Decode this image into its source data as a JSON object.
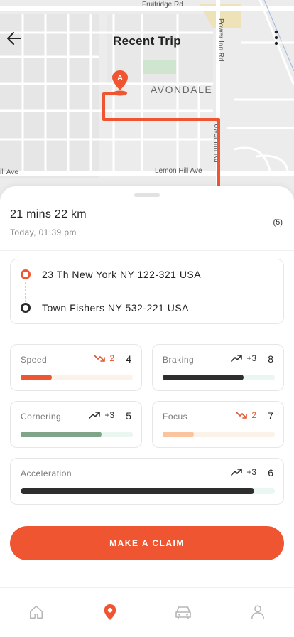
{
  "header": {
    "title": "Recent Trip"
  },
  "map": {
    "labels": {
      "fruitridge": "Fruitridge Rd",
      "power_inn_top": "Power Inn Rd",
      "power_inn_mid": "Power Inn Rd",
      "avondale": "AVONDALE",
      "lemon_hill": "Lemon Hill Ave",
      "hill_ave": "ill Ave"
    },
    "marker_label": "A",
    "route_color": "#ef5530"
  },
  "trip": {
    "summary": "21 mins 22 km",
    "time": "Today, 01:39 pm",
    "rating": "(5)",
    "start_address": "23 Th New York NY 122-321 USA",
    "end_address": "Town Fishers NY 532-221 USA"
  },
  "metrics": {
    "speed": {
      "label": "Speed",
      "trend": "2",
      "direction": "down",
      "score": "4",
      "progress": 0.28,
      "bar_color": "#ef5530",
      "track_color": "#fbf3ea"
    },
    "braking": {
      "label": "Braking",
      "trend": "+3",
      "direction": "up",
      "score": "8",
      "progress": 0.72,
      "bar_color": "#2e2e2e",
      "track_color": "#eaf6f0"
    },
    "cornering": {
      "label": "Cornering",
      "trend": "+3",
      "direction": "up",
      "score": "5",
      "progress": 0.72,
      "bar_color": "#7fa487",
      "track_color": "#eaf6f0"
    },
    "focus": {
      "label": "Focus",
      "trend": "2",
      "direction": "down",
      "score": "7",
      "progress": 0.28,
      "bar_color": "#f9c49e",
      "track_color": "#fbf3ea"
    },
    "acceleration": {
      "label": "Acceleration",
      "trend": "+3",
      "direction": "up",
      "score": "6",
      "progress": 0.92,
      "bar_color": "#2e2e2e",
      "track_color": "#eaf6f0"
    }
  },
  "actions": {
    "claim_label": "MAKE A CLAIM"
  },
  "tabs": [
    {
      "icon": "home-icon",
      "active": false
    },
    {
      "icon": "location-pin-icon",
      "active": true
    },
    {
      "icon": "car-icon",
      "active": false
    },
    {
      "icon": "user-icon",
      "active": false
    }
  ],
  "colors": {
    "accent": "#ef5530",
    "down_trend": "#e0532d",
    "up_trend": "#333333"
  }
}
